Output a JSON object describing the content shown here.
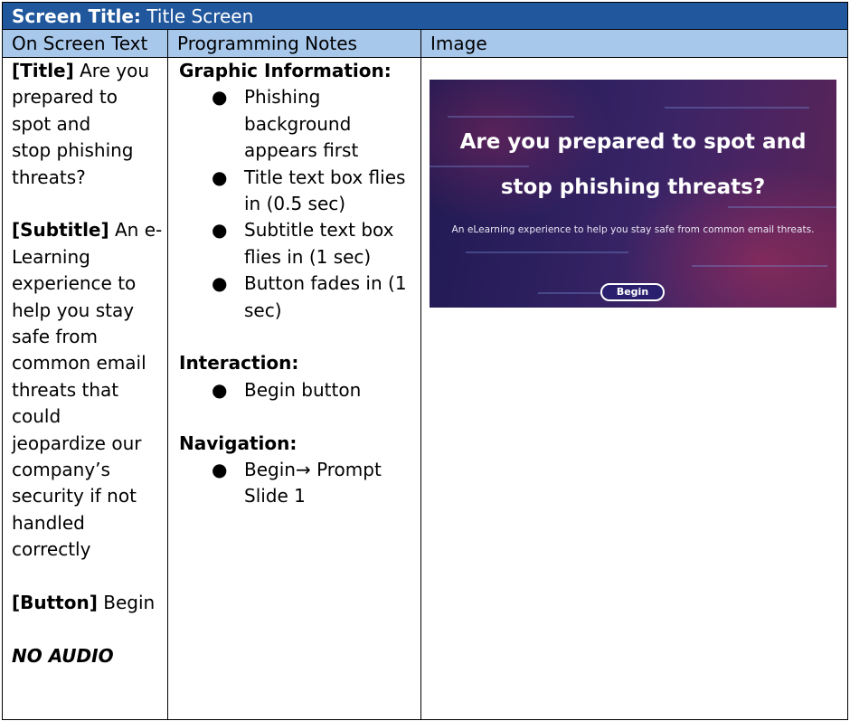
{
  "screen_title": {
    "label": "Screen Title:",
    "value": "Title Screen"
  },
  "headers": {
    "on_screen_text": "On Screen Text",
    "programming_notes": "Programming Notes",
    "image": "Image"
  },
  "on_screen_text": {
    "title_tag": "[Title]",
    "title_text_1": "Are you",
    "title_text_2": "prepared to",
    "title_text_3": "spot and",
    "title_text_4": "stop phishing",
    "title_text_5": "threats?",
    "subtitle_tag": "[Subtitle]",
    "subtitle_text_1": "An e-",
    "subtitle_lines": [
      "Learning",
      "experience to",
      "help you stay",
      "safe from",
      "common email",
      "threats that",
      "could",
      "jeopardize our",
      "company’s",
      "security if not",
      "handled",
      "correctly"
    ],
    "button_tag": "[Button]",
    "button_text": "Begin",
    "audio_note": "NO AUDIO"
  },
  "programming_notes": {
    "graphic_heading": "Graphic Information:",
    "graphic_items": [
      {
        "line1": "Phishing",
        "line2": "background",
        "line3": "appears first"
      },
      {
        "line1": "Title text box flies",
        "line2": "in (0.5 sec)"
      },
      {
        "line1": "Subtitle text box",
        "line2": "flies in (1 sec)"
      },
      {
        "line1": "Button fades in (1",
        "line2": "sec)"
      }
    ],
    "interaction_heading": "Interaction:",
    "interaction_items": [
      "Begin button"
    ],
    "navigation_heading": "Navigation:",
    "navigation_items": [
      {
        "line1": "Begin→ Prompt",
        "line2": "Slide 1"
      }
    ],
    "bullet": "●"
  },
  "slide_preview": {
    "title_line1": "Are you prepared to spot and",
    "title_line2": "stop phishing threats?",
    "subtitle": "An eLearning experience to help you stay safe from common email threats.",
    "button_label": "Begin",
    "colors": {
      "background_left": "#201a52",
      "background_right": "#5a2455",
      "button_fill": "#2a1f6e"
    }
  },
  "colors": {
    "title_bar": "#21579c",
    "header_row": "#a7c7eb"
  }
}
